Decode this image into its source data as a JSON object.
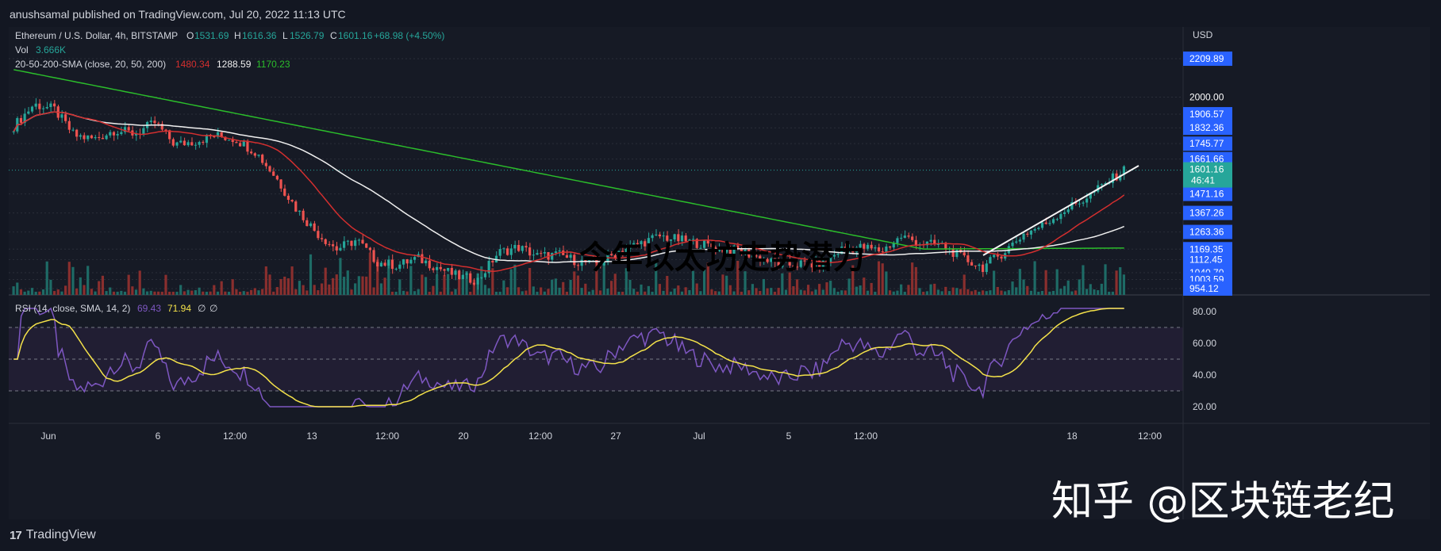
{
  "header": {
    "published_line": "anushsamal published on TradingView.com, Jul 20, 2022 11:13 UTC"
  },
  "legend": {
    "symbol": "Ethereum / U.S. Dollar, 4h, BITSTAMP",
    "o_label": "O",
    "o_value": "1531.69",
    "h_label": "H",
    "h_value": "1616.36",
    "l_label": "L",
    "l_value": "1526.79",
    "c_label": "C",
    "c_value": "1601.16",
    "change": "+68.98 (+4.50%)",
    "vol_label": "Vol",
    "vol_value": "3.666K",
    "sma_label": "20-50-200-SMA (close, 20, 50, 200)",
    "sma20_value": "1480.34",
    "sma50_value": "1288.59",
    "sma200_value": "1170.23",
    "rsi_label": "RSI (14, close, SMA, 14, 2)",
    "rsi_value": "69.43",
    "rsi_sma_value": "71.94",
    "rsi_extra1": "∅",
    "rsi_extra2": "∅"
  },
  "price_axis": {
    "currency": "USD",
    "labels": [
      "2209.89",
      "2000.00",
      "1906.57",
      "1832.36",
      "1745.77",
      "1661.66",
      "1471.16",
      "1367.26",
      "1263.36",
      "1169.35",
      "1112.45",
      "1040.70",
      "1003.59",
      "954.12"
    ],
    "current_price": "1601.16",
    "countdown": "46:41"
  },
  "rsi_axis": {
    "labels": [
      "80.00",
      "60.00",
      "40.00",
      "20.00"
    ]
  },
  "time_axis": {
    "labels": [
      "Jun",
      "6",
      "12:00",
      "13",
      "12:00",
      "20",
      "12:00",
      "27",
      "Jul",
      "5",
      "12:00",
      "18",
      "12:00"
    ]
  },
  "overlay_title": "今年以太坊走势潜力",
  "watermark": "知乎 @区块链老纪",
  "footer": {
    "brand": "TradingView",
    "mark": "17"
  },
  "colors": {
    "background": "#161a25",
    "up": "#26a69a",
    "down": "#ef5350",
    "sma20": "#d32f2f",
    "sma50": "#f0f0f0",
    "sma200": "#2bbd2b",
    "rsi": "#7e57c2",
    "rsi_sma": "#f4e24a",
    "axis_highlight": "#2962ff"
  },
  "chart_data": {
    "type": "candlestick",
    "title": "Ethereum / U.S. Dollar, 4h, BITSTAMP",
    "x": [
      "Jun",
      "6",
      "12:00",
      "13",
      "12:00",
      "20",
      "12:00",
      "27",
      "Jul",
      "5",
      "12:00",
      "18",
      "12:00"
    ],
    "close_path": [
      1840,
      1960,
      1935,
      1790,
      1770,
      1820,
      1800,
      1860,
      1740,
      1760,
      1790,
      1770,
      1700,
      1560,
      1390,
      1260,
      1170,
      1220,
      1100,
      1080,
      1120,
      1070,
      1020,
      1000,
      1150,
      1180,
      1130,
      1140,
      1100,
      1090,
      1160,
      1200,
      1240,
      1220,
      1200,
      1170,
      1160,
      1120,
      1080,
      1090,
      1080,
      1170,
      1180,
      1160,
      1240,
      1200,
      1190,
      1120,
      1070,
      1150,
      1250,
      1300,
      1380,
      1440,
      1520,
      1601
    ],
    "ylim": [
      954,
      2210
    ],
    "series": [
      {
        "name": "SMA 20",
        "last": 1480.34
      },
      {
        "name": "SMA 50",
        "last": 1288.59
      },
      {
        "name": "SMA 200",
        "last": 1170.23
      },
      {
        "name": "RSI",
        "last": 69.43
      },
      {
        "name": "RSI SMA",
        "last": 71.94
      }
    ]
  }
}
